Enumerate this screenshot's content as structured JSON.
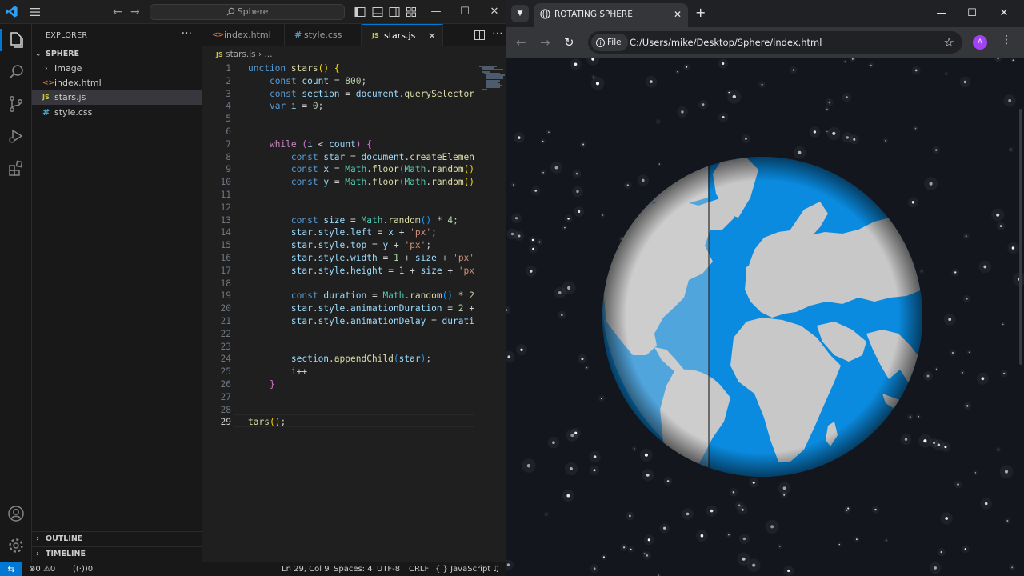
{
  "vscode": {
    "command_center": "Sphere",
    "explorer_title": "EXPLORER",
    "explorer_more": "···",
    "folder": "SPHERE",
    "tree": [
      {
        "label": "Image",
        "type": "folder"
      },
      {
        "label": "index.html",
        "type": "html"
      },
      {
        "label": "stars.js",
        "type": "js",
        "selected": true
      },
      {
        "label": "style.css",
        "type": "css"
      }
    ],
    "outline": "OUTLINE",
    "timeline": "TIMELINE",
    "tabs": [
      {
        "label": "index.html",
        "type": "html"
      },
      {
        "label": "style.css",
        "type": "css"
      },
      {
        "label": "stars.js",
        "type": "js",
        "active": true
      }
    ],
    "breadcrumb": {
      "file": "stars.js",
      "rest": "..."
    },
    "line_numbers": [
      "1",
      "2",
      "3",
      "4",
      "5",
      "6",
      "7",
      "8",
      "9",
      "10",
      "11",
      "12",
      "13",
      "14",
      "15",
      "16",
      "17",
      "18",
      "19",
      "20",
      "21",
      "22",
      "23",
      "24",
      "25",
      "26",
      "27",
      "28",
      "29"
    ],
    "status": {
      "errors": "0",
      "warnings": "0",
      "ports": "0",
      "position": "Ln 29, Col 9",
      "spaces": "Spaces: 4",
      "encoding": "UTF-8",
      "eol": "CRLF",
      "language": "JavaScript"
    },
    "colors": {
      "accent": "#0078d4",
      "background": "#1f1f1f"
    }
  },
  "browser": {
    "tab_title": "ROTATING SPHERE",
    "site_chip": "File",
    "url": "C:/Users/mike/Desktop/Sphere/index.html",
    "profile_initial": "A",
    "colors": {
      "ocean": "#0a8be0",
      "land": "#c8c8c8",
      "sky": "#14161d",
      "profile": "#a142f4"
    }
  }
}
